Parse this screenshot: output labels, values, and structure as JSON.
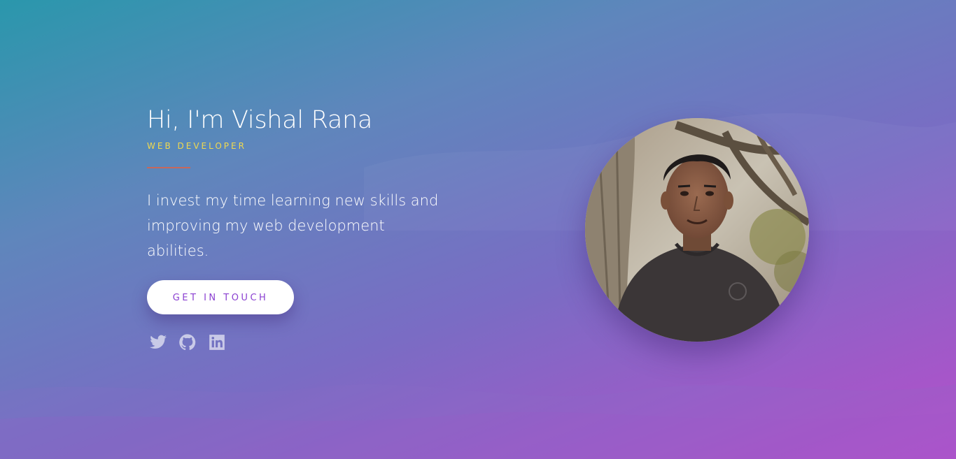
{
  "hero": {
    "greeting": "Hi, I'm Vishal Rana",
    "role": "WEB DEVELOPER",
    "tagline": "I invest my time learning new skills and improving my web development abilities.",
    "cta_label": "GET IN TOUCH"
  },
  "socials": [
    {
      "icon": "twitter-icon"
    },
    {
      "icon": "github-icon"
    },
    {
      "icon": "linkedin-icon"
    }
  ],
  "profile_photo": {
    "subject": "portrait-photo"
  },
  "colors": {
    "gradient_start": "#2a97ac",
    "gradient_mid": "#7a6cc4",
    "gradient_end": "#b64ecb",
    "role_accent": "#f1d94e",
    "divider": "#d9634a",
    "button_text": "#8a3fd1",
    "button_bg": "#ffffff"
  }
}
